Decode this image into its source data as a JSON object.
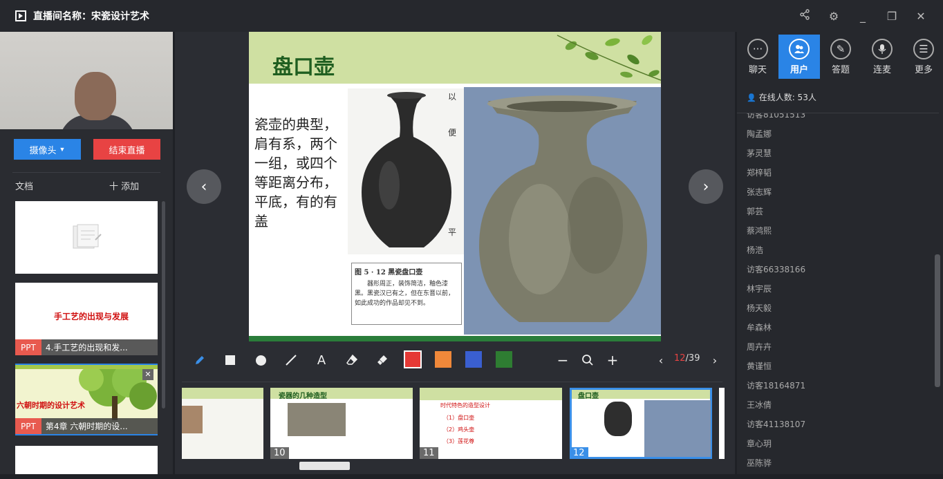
{
  "window": {
    "title": "直播间名称：宋瓷设计艺术"
  },
  "left": {
    "camera_label": "摄像头",
    "end_live_label": "结束直播",
    "docs_label": "文档",
    "add_label": "十 添加",
    "docs": [
      {
        "type": "",
        "name": "",
        "preview": ""
      },
      {
        "type": "PPT",
        "name": "4.手工艺的出现和发...",
        "preview": "手工艺的出现与发展"
      },
      {
        "type": "PPT",
        "name": "第4章 六朝时期的设...",
        "preview": "六朝时期的设计艺术"
      }
    ]
  },
  "slide": {
    "title": "盘口壶",
    "body": "瓷壶的典型，肩有系，两个一组，或四个等距离分布，平底，有的有盖",
    "caption_title": "图 5 · 12  黑瓷盘口壶",
    "caption_body": "器形周正，装饰简洁，釉色漆黑。黑瓷汉已有之，但在东晋以前，如此成功的作品却见不到。",
    "side_frags": [
      "以",
      "便",
      "平"
    ]
  },
  "toolbar": {
    "page_current": "12",
    "page_total": "/39",
    "colors": [
      "#e53935",
      "#f0883a",
      "#3a5fd0",
      "#2e7d32"
    ]
  },
  "thumbnails": [
    {
      "num": "",
      "title": ""
    },
    {
      "num": "10",
      "title": "瓷器的几种造型"
    },
    {
      "num": "11",
      "title": "时代特色的造型设计",
      "items": [
        "（1）盘口壶",
        "（2）鸡头壶",
        "（3）莲花尊"
      ]
    },
    {
      "num": "12",
      "title": "盘口壶"
    }
  ],
  "right": {
    "tabs": [
      {
        "label": "聊天",
        "icon": "chat-icon"
      },
      {
        "label": "用户",
        "icon": "users-icon"
      },
      {
        "label": "答题",
        "icon": "pen-icon"
      },
      {
        "label": "连麦",
        "icon": "mic-icon"
      },
      {
        "label": "更多",
        "icon": "more-icon"
      }
    ],
    "online_count": "在线人数: 53人",
    "users": [
      "访客81051513",
      "陶孟娜",
      "茅灵慧",
      "郑梓韬",
      "张志辉",
      "郭芸",
      "蔡鸿熙",
      "杨浩",
      "访客66338166",
      "林宇辰",
      "杨天毅",
      "牟森林",
      "周卉卉",
      "黄谨恒",
      "访客18164871",
      "王冰倩",
      "访客41138107",
      "章心玥",
      "巫陈骅"
    ]
  }
}
